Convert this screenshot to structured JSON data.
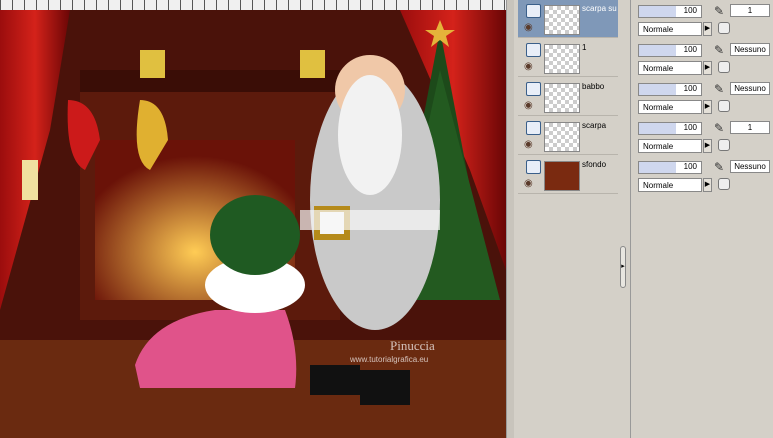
{
  "layers": [
    {
      "name": "scarpa su",
      "selected": true
    },
    {
      "name": "1",
      "selected": false
    },
    {
      "name": "babbo",
      "selected": false
    },
    {
      "name": "scarpa",
      "selected": false
    },
    {
      "name": "sfondo",
      "selected": false
    }
  ],
  "props": [
    {
      "opacity": "100",
      "blend": "Normale",
      "link": "1"
    },
    {
      "opacity": "100",
      "blend": "Normale",
      "link": "Nessuno"
    },
    {
      "opacity": "100",
      "blend": "Normale",
      "link": "Nessuno"
    },
    {
      "opacity": "100",
      "blend": "Normale",
      "link": "1"
    },
    {
      "opacity": "100",
      "blend": "Normale",
      "link": "Nessuno"
    }
  ],
  "watermark": {
    "line1": "Pinuccia",
    "line2": "www.tutorialgrafica.eu"
  }
}
